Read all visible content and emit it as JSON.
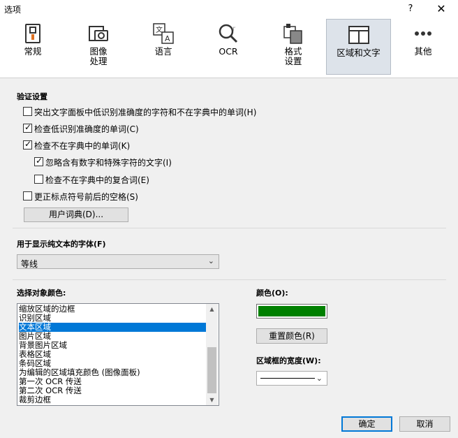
{
  "window": {
    "title": "选项",
    "help": "?",
    "close": "✕"
  },
  "tabs": [
    {
      "id": "general",
      "label": "常规"
    },
    {
      "id": "image",
      "label": "图像\n处理"
    },
    {
      "id": "language",
      "label": "语言"
    },
    {
      "id": "ocr",
      "label": "OCR"
    },
    {
      "id": "format",
      "label": "格式\n设置"
    },
    {
      "id": "region",
      "label": "区域和文字",
      "selected": true
    },
    {
      "id": "other",
      "label": "其他"
    }
  ],
  "verify": {
    "heading": "验证设置",
    "options": [
      {
        "label": "突出文字面板中低识别准确度的字符和不在字典中的单词(H)",
        "checked": false
      },
      {
        "label": "检查低识别准确度的单词(C)",
        "checked": true
      },
      {
        "label": "检查不在字典中的单词(K)",
        "checked": true
      },
      {
        "label": "忽略含有数字和特殊字符的文字(I)",
        "checked": true
      },
      {
        "label": "检查不在字典中的复合词(E)",
        "checked": false
      },
      {
        "label": "更正标点符号前后的空格(S)",
        "checked": false
      }
    ],
    "user_dict_button": "用户词典(D)..."
  },
  "font": {
    "heading": "用于显示纯文本的字体(F)",
    "selected": "等线"
  },
  "object_color": {
    "heading": "选择对象颜色:",
    "items": [
      "缩放区域的边框",
      "识别区域",
      "文本区域",
      "图片区域",
      "背景图片区域",
      "表格区域",
      "条码区域",
      "为编辑的区域填充颜色 (图像面板)",
      "第一次 OCR 传送",
      "第二次 OCR 传送",
      "裁剪边框"
    ],
    "selected_index": 2
  },
  "color": {
    "heading": "颜色(O):",
    "value": "#008000",
    "reset_button": "重置颜色(R)"
  },
  "frame_width": {
    "heading": "区域框的宽度(W):"
  },
  "footer": {
    "ok": "确定",
    "cancel": "取消"
  }
}
